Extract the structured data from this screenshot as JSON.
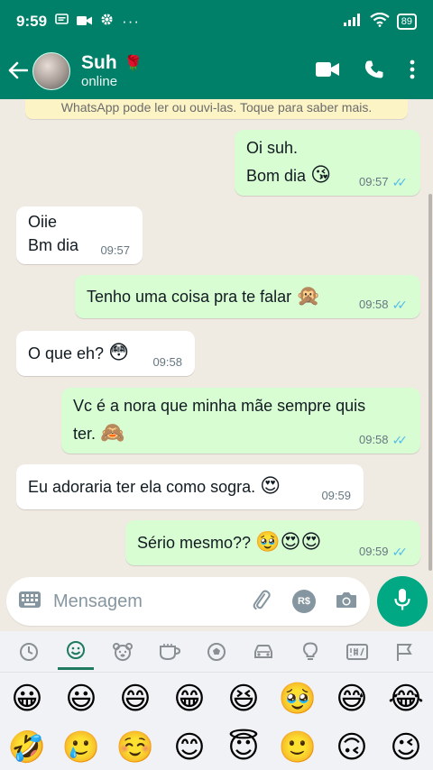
{
  "status_bar": {
    "time": "9:59",
    "left_icons": [
      "message-icon",
      "video-icon",
      "settings-icon",
      "more-dots-icon"
    ],
    "right_icons": [
      "signal-icon",
      "wifi-icon"
    ],
    "battery": "89"
  },
  "header": {
    "contact_name": "Suh",
    "name_emoji": "🌹",
    "status": "online"
  },
  "chat": {
    "notice": "WhatsApp pode ler ou ouvi-las. Toque para saber mais.",
    "messages": [
      {
        "dir": "out",
        "text": "Oi suh.\nBom dia",
        "emoji": "😘",
        "time": "09:57",
        "ticks": "✓✓"
      },
      {
        "dir": "in",
        "text": "Oiie\nBm dia",
        "emoji": "",
        "time": "09:57",
        "ticks": ""
      },
      {
        "dir": "out",
        "text": "Tenho uma coisa pra te falar",
        "emoji": "🙊",
        "time": "09:58",
        "ticks": "✓✓"
      },
      {
        "dir": "in",
        "text": "O que eh?",
        "emoji": "😳",
        "time": "09:58",
        "ticks": ""
      },
      {
        "dir": "out",
        "text": "Vc é a nora que minha mãe sempre quis\nter.",
        "emoji": "🙈",
        "time": "09:58",
        "ticks": "✓✓"
      },
      {
        "dir": "in",
        "text": "Eu adoraria ter ela como sogra.",
        "emoji": "😍",
        "time": "09:59",
        "ticks": ""
      },
      {
        "dir": "out",
        "text": "Sério mesmo??",
        "emoji": "🥹😍😍",
        "time": "09:59",
        "ticks": "✓✓"
      }
    ]
  },
  "composer": {
    "placeholder": "Mensagem",
    "currency_badge": "R$"
  },
  "keyboard": {
    "tabs": [
      "recent-icon",
      "smiley-icon",
      "animal-icon",
      "food-icon",
      "sports-icon",
      "car-icon",
      "bulb-icon",
      "symbols-icon",
      "flag-icon"
    ],
    "active_tab": "smiley-icon",
    "emojis": [
      "😀",
      "😃",
      "😄",
      "😁",
      "😆",
      "🥹",
      "😅",
      "😂",
      "🤣",
      "🥲",
      "☺️",
      "😊",
      "😇",
      "🙂",
      "🙃",
      "😉"
    ]
  },
  "colors": {
    "brand": "#008069",
    "outgoing_bubble": "#d9fdd3",
    "incoming_bubble": "#ffffff",
    "read_ticks": "#53bdeb",
    "mic_button": "#00a884"
  }
}
